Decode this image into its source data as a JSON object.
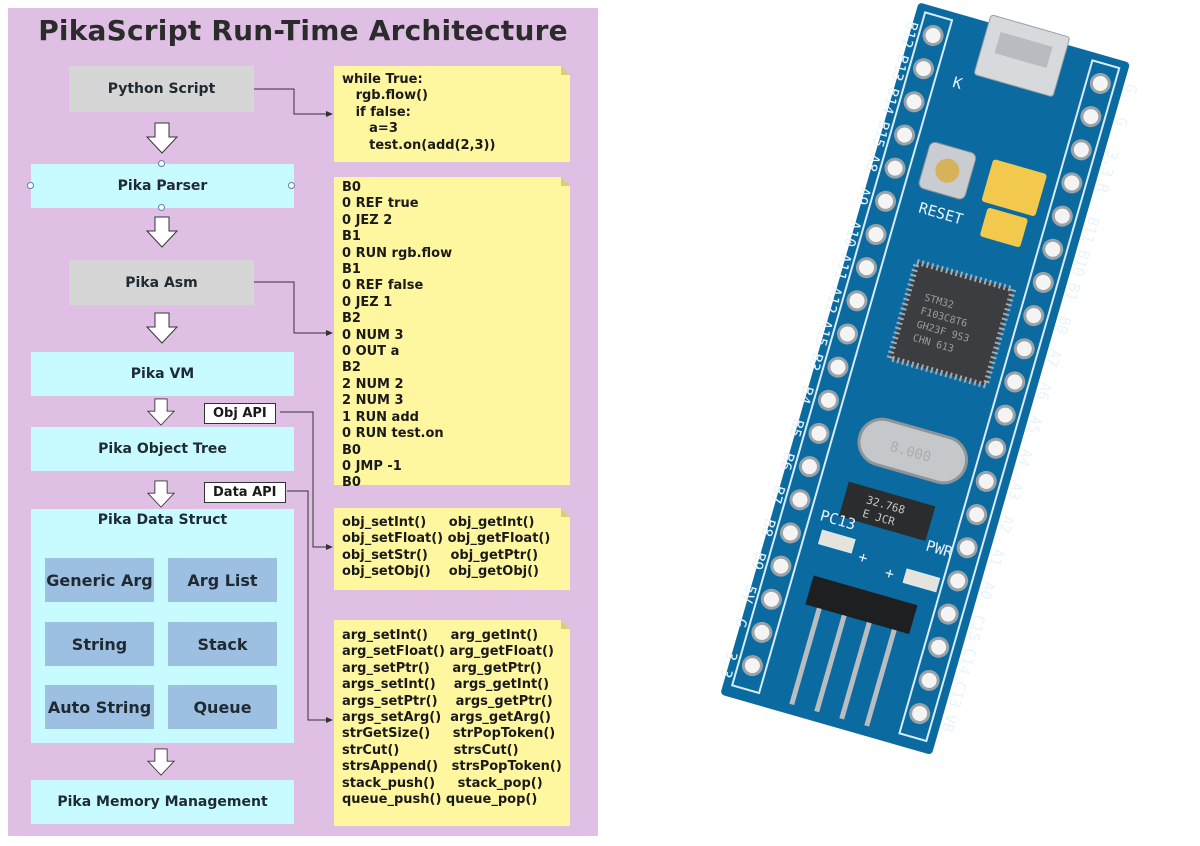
{
  "diagram": {
    "title": "PikaScript Run-Time Architecture",
    "stages": [
      {
        "id": "python-script",
        "label": "Python Script",
        "style": "gray"
      },
      {
        "id": "pika-parser",
        "label": "Pika Parser",
        "style": "cyan"
      },
      {
        "id": "pika-asm",
        "label": "Pika Asm",
        "style": "gray"
      },
      {
        "id": "pika-vm",
        "label": "Pika VM",
        "style": "cyan"
      },
      {
        "id": "pika-object-tree",
        "label": "Pika Object Tree",
        "style": "cyan"
      },
      {
        "id": "pika-data-struct",
        "label": "Pika Data Struct",
        "style": "cyan"
      },
      {
        "id": "pika-memory-management",
        "label": "Pika Memory Management",
        "style": "cyan"
      }
    ],
    "data_struct_items": [
      "Generic Arg",
      "Arg List",
      "String",
      "Stack",
      "Auto String",
      "Queue"
    ],
    "api_labels": {
      "obj_api": "Obj API",
      "data_api": "Data API"
    },
    "notes": {
      "python_code": "while True:\n   rgb.flow()\n   if false:\n      a=3\n      test.on(add(2,3))",
      "asm_code": "B0\n0 REF true\n0 JEZ 2\nB1\n0 RUN rgb.flow\nB1\n0 REF false\n0 JEZ 1\nB2\n0 NUM 3\n0 OUT a\nB2\n2 NUM 2\n2 NUM 3\n1 RUN add\n0 RUN test.on\nB0\n0 JMP -1\nB0",
      "obj_api_funcs": "obj_setInt()     obj_getInt()\nobj_setFloat() obj_getFloat()\nobj_setStr()     obj_getPtr()\nobj_setObj()    obj_getObj()",
      "data_api_funcs": "arg_setInt()     arg_getInt()\narg_setFloat() arg_getFloat()\narg_setPtr()     arg_getPtr()\nargs_setInt()    args_getInt()\nargs_setPtr()    args_getPtr()\nargs_setArg()  args_getArg()\nstrGetSize()     strPopToken()\nstrCut()            strsCut()\nstrsAppend()   strsPopToken()\nstack_push()     stack_pop()\nqueue_push() queue_pop()"
    },
    "colors": {
      "background": "#e0bfe5",
      "gray_box": "#d6d6d6",
      "cyan_box": "#c8fbff",
      "inner_box": "#9dbfe2",
      "note": "#fff7a0"
    }
  },
  "board": {
    "description": "STM32 Blue Pill development board",
    "chip_text": [
      "STM32",
      "F103C8T6",
      "GH23F 9S3",
      "CHN 613"
    ],
    "crystal_text": "8.000",
    "rtc_crystal_text": [
      "32.768",
      "E  JCR"
    ],
    "silkscreen": {
      "reset": "RESET",
      "pc13": "PC13",
      "pwr": "PWR",
      "k": "K",
      "plus1": "+",
      "plus2": "+"
    },
    "left_pins": [
      "B12",
      "B13",
      "B14",
      "B15",
      "A8",
      "A9",
      "A10",
      "A11",
      "A12",
      "A15",
      "B3",
      "B4",
      "B5",
      "B6",
      "B7",
      "B8",
      "B9",
      "5V",
      "G",
      "3.3"
    ],
    "right_pins": [
      "G",
      "G",
      "3.3",
      "R",
      "B11",
      "B10",
      "B1",
      "B0",
      "A7",
      "A6",
      "A5",
      "A4",
      "A3",
      "A2",
      "A1",
      "A0",
      "C15",
      "C14",
      "C13",
      "VB"
    ],
    "colors": {
      "pcb": "#0b6aa0",
      "pcb_dark": "#07507c",
      "silk": "#e8f4fb",
      "jumper": "#f2c94c"
    }
  }
}
